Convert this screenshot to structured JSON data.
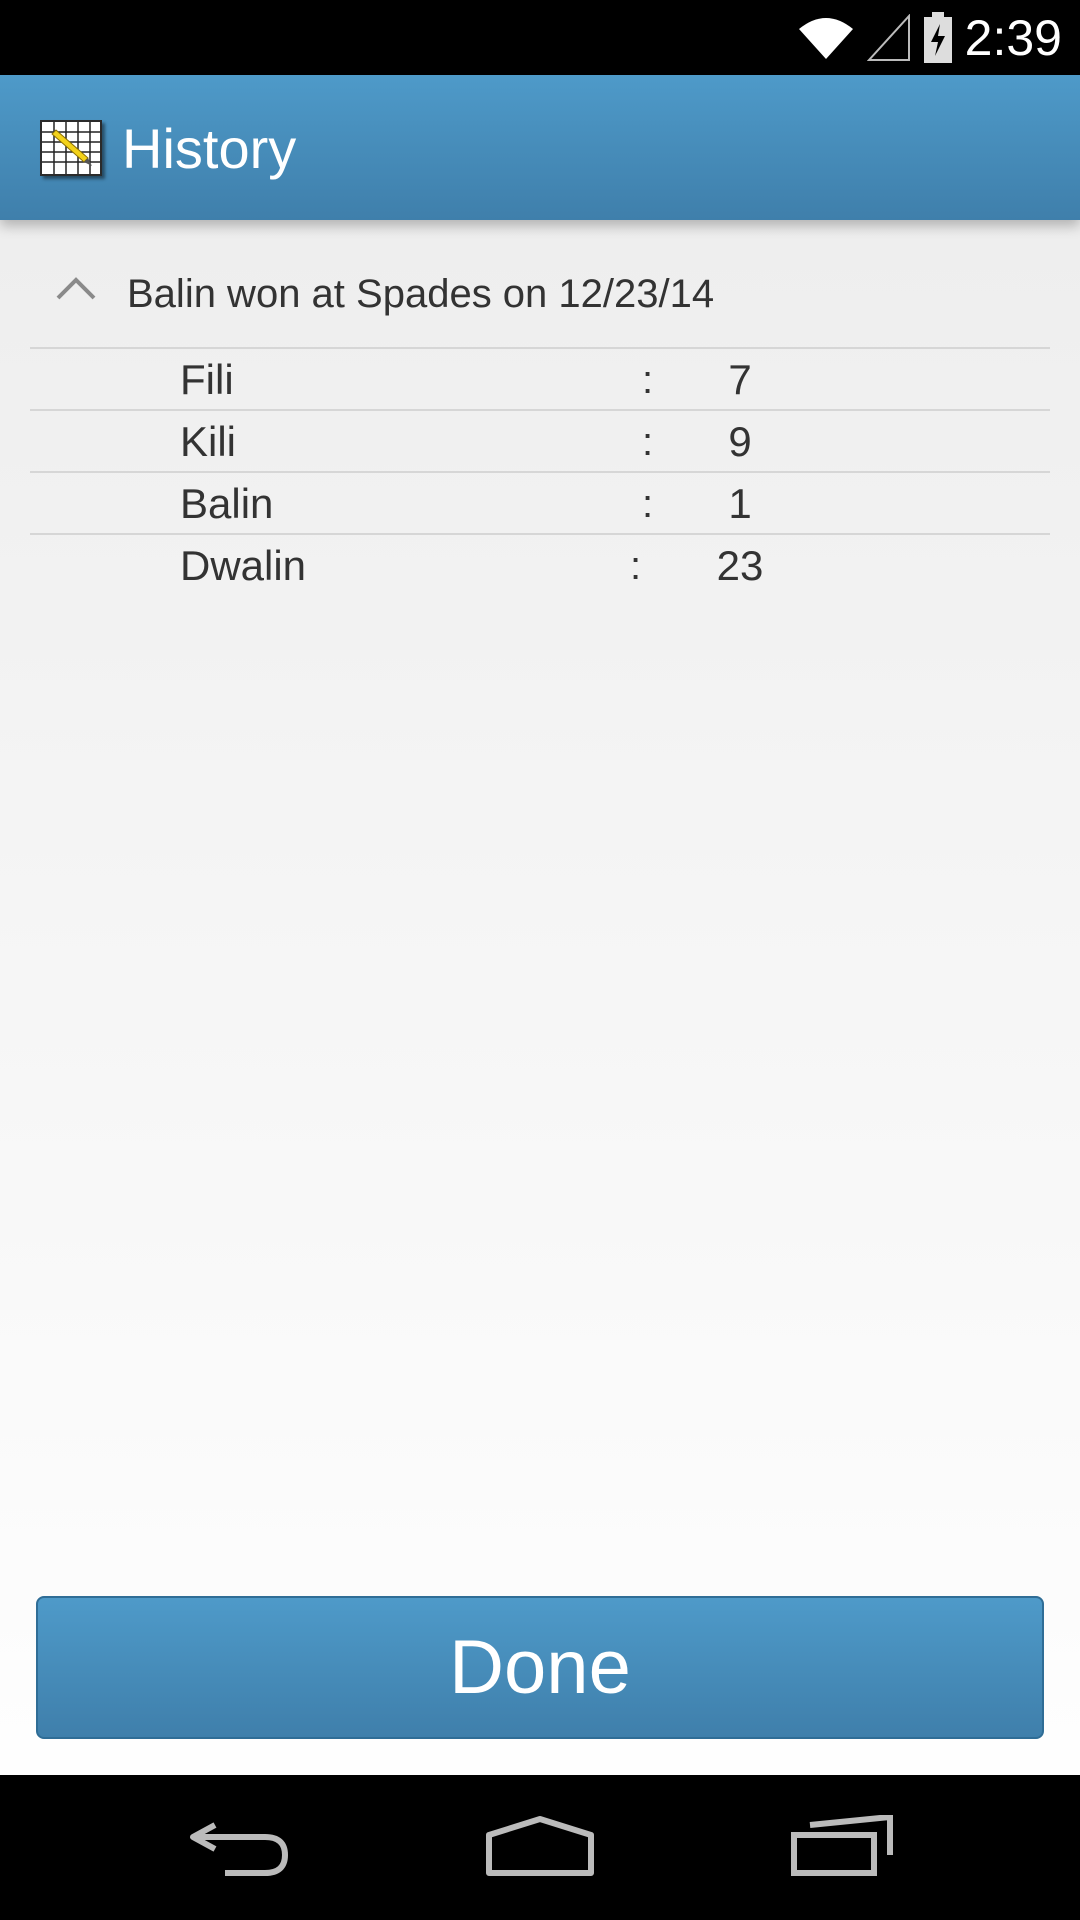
{
  "status_bar": {
    "time": "2:39",
    "icons": [
      "wifi-icon",
      "cell-signal-icon",
      "battery-charging-icon"
    ]
  },
  "action_bar": {
    "title": "History",
    "icon": "scoresheet-app-icon"
  },
  "history": {
    "group_title": "Balin won at Spades on 12/23/14",
    "expanded": true,
    "scores": [
      {
        "name": "Fili",
        "sep": ":",
        "score": "7"
      },
      {
        "name": "Kili",
        "sep": ":",
        "score": "9"
      },
      {
        "name": "Balin",
        "sep": ":",
        "score": "1"
      },
      {
        "name": "Dwalin",
        "sep": ":",
        "score": "23"
      }
    ]
  },
  "done_button": {
    "label": "Done"
  },
  "nav_bar": {
    "buttons": [
      "back-icon",
      "home-icon",
      "recent-apps-icon"
    ]
  },
  "colors": {
    "accent": "#4a90c0",
    "background_top": "#eeeeee",
    "background_bottom": "#fefefe",
    "text": "#333333"
  }
}
